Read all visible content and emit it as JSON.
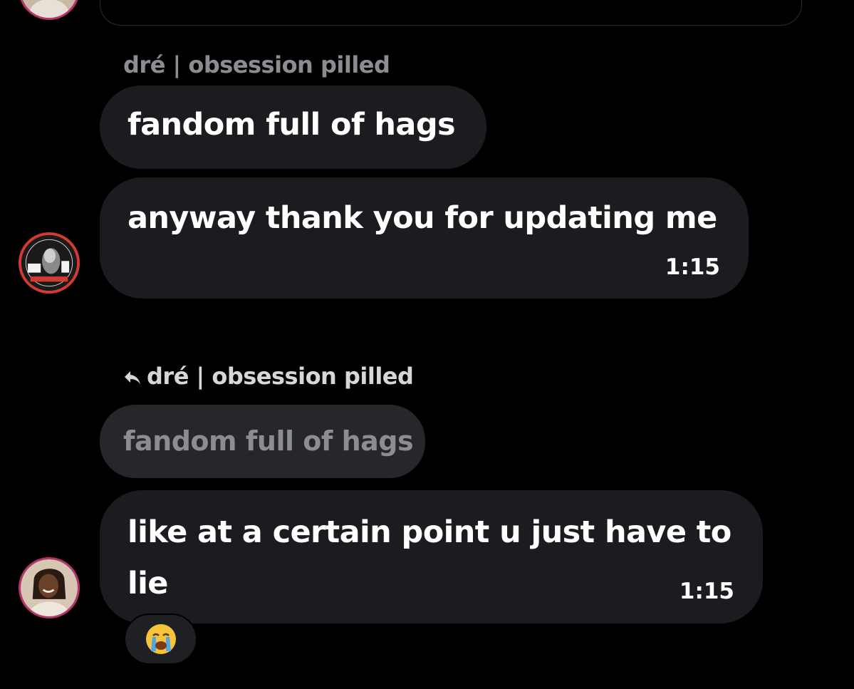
{
  "colors": {
    "background": "#000000",
    "bubble": "#1b1c1f",
    "quoted_bubble": "#26272b",
    "sender_muted": "#8b8d92",
    "sender_bright": "#d6d7da",
    "avatar_ring_red": "#d23b32",
    "avatar_ring_pink": "#b8336a"
  },
  "messages": [
    {
      "sender": "dré | obsession pilled",
      "bubbles": [
        {
          "text": "fandom full of hags"
        },
        {
          "text": "anyway thank you for updating me",
          "time": "1:15"
        }
      ],
      "avatar": "profile-avatar-icon"
    },
    {
      "reply_to": {
        "icon": "reply-arrow-icon",
        "sender": "dré | obsession pilled",
        "quoted_text": "fandom full of hags"
      },
      "bubble": {
        "line1": "like at a certain point u just have to",
        "line2": "lie",
        "time": "1:15"
      },
      "reaction": {
        "emoji": "😭",
        "name": "loudly-crying-face-icon"
      },
      "avatar": "profile-avatar-icon"
    }
  ]
}
